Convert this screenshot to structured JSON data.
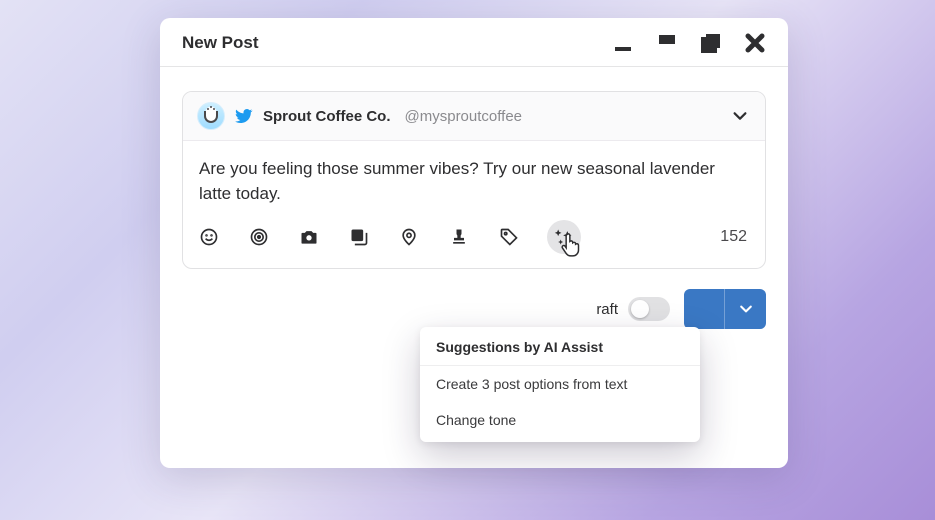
{
  "header": {
    "title": "New Post"
  },
  "account": {
    "name": "Sprout Coffee Co.",
    "handle": "@mysproutcoffee"
  },
  "compose": {
    "text": "Are you feeling those summer vibes? Try our new seasonal lavender latte today.",
    "char_count": "152"
  },
  "toolbar": {
    "icons": [
      "emoji",
      "target",
      "camera",
      "media-stack",
      "location-pin",
      "stamp",
      "tag",
      "ai-assist"
    ]
  },
  "footer": {
    "draft_label": "raft",
    "primary_label": ""
  },
  "ai_popover": {
    "title": "Suggestions by AI Assist",
    "items": [
      "Create 3 post options from text",
      "Change tone"
    ]
  }
}
